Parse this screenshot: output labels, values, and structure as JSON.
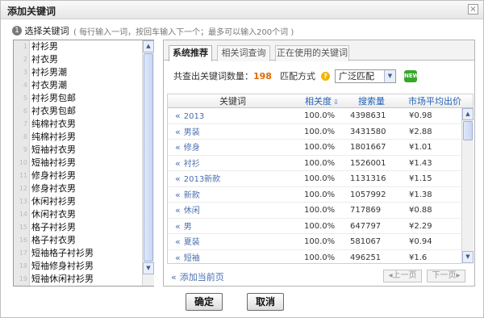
{
  "dialog": {
    "title": "添加关键词",
    "close_glyph": "×"
  },
  "step": {
    "number": "1",
    "title": "选择关键词",
    "hint": "( 每行输入一词，按回车输入下一个；最多可以输入200个词 )"
  },
  "keyword_list": [
    "衬衫男",
    "衬衣男",
    "衬衫男潮",
    "衬衣男潮",
    "衬衫男包邮",
    "衬衣男包邮",
    "纯棉衬衣男",
    "纯棉衬衫男",
    "短袖衬衣男",
    "短袖衬衫男",
    "修身衬衫男",
    "修身衬衣男",
    "休闲衬衫男",
    "休闲衬衣男",
    "格子衬衫男",
    "格子衬衣男",
    "短袖格子衬衫男",
    "短袖修身衬衫男",
    "短袖休闲衬衫男"
  ],
  "tabs": [
    "系统推荐",
    "相关词查询",
    "正在使用的关键词"
  ],
  "info": {
    "count_label": "共查出关键词数量：",
    "count_value": "198",
    "match_label": "匹配方式",
    "match_value": "广泛匹配",
    "new_badge": "NEW"
  },
  "table": {
    "headers": {
      "keyword": "关键词",
      "relevance": "相关度",
      "search_volume": "搜索量",
      "avg_price": "市场平均出价"
    },
    "rows": [
      {
        "keyword": "2013",
        "relevance": "100.0%",
        "search_volume": "4398631",
        "avg_price": "¥0.98"
      },
      {
        "keyword": "男装",
        "relevance": "100.0%",
        "search_volume": "3431580",
        "avg_price": "¥2.88"
      },
      {
        "keyword": "修身",
        "relevance": "100.0%",
        "search_volume": "1801667",
        "avg_price": "¥1.01"
      },
      {
        "keyword": "衬衫",
        "relevance": "100.0%",
        "search_volume": "1526001",
        "avg_price": "¥1.43"
      },
      {
        "keyword": "2013新款",
        "relevance": "100.0%",
        "search_volume": "1131316",
        "avg_price": "¥1.15"
      },
      {
        "keyword": "新款",
        "relevance": "100.0%",
        "search_volume": "1057992",
        "avg_price": "¥1.38"
      },
      {
        "keyword": "休闲",
        "relevance": "100.0%",
        "search_volume": "717869",
        "avg_price": "¥0.88"
      },
      {
        "keyword": "男",
        "relevance": "100.0%",
        "search_volume": "647797",
        "avg_price": "¥2.29"
      },
      {
        "keyword": "夏装",
        "relevance": "100.0%",
        "search_volume": "581067",
        "avg_price": "¥0.94"
      },
      {
        "keyword": "短袖",
        "relevance": "100.0%",
        "search_volume": "496251",
        "avg_price": "¥1.6"
      }
    ]
  },
  "footer": {
    "add_link": "添加当前页",
    "prev": "上一页",
    "next": "下一页"
  },
  "buttons": {
    "confirm": "确定",
    "cancel": "取消"
  },
  "colors": {
    "link_blue": "#4a6fb0",
    "count_orange": "#e06a00",
    "new_green": "#37a82a",
    "help_yellow": "#f2b400"
  }
}
